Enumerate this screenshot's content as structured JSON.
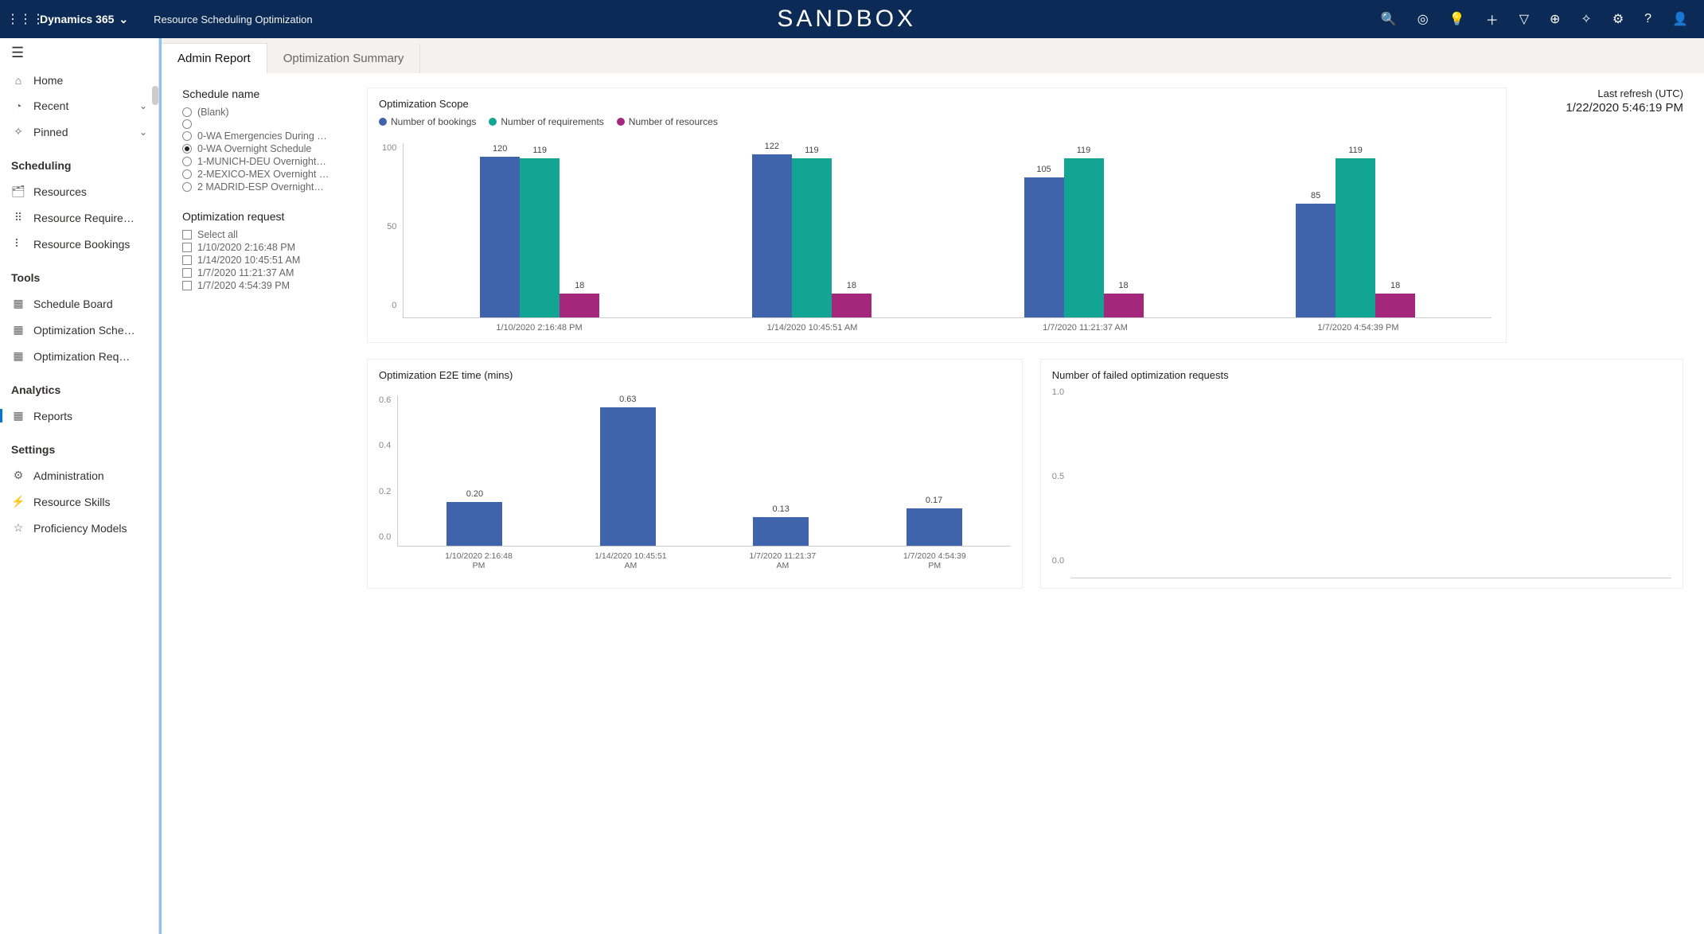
{
  "topbar": {
    "product": "Dynamics 365",
    "app": "Resource Scheduling Optimization",
    "env": "SANDBOX"
  },
  "sidebar": {
    "top": [
      {
        "icon": "⌂",
        "label": "Home"
      },
      {
        "icon": "◔",
        "label": "Recent",
        "chevron": true
      },
      {
        "icon": "✧",
        "label": "Pinned",
        "chevron": true
      }
    ],
    "sections": [
      {
        "header": "Scheduling",
        "items": [
          {
            "icon": "🗂",
            "label": "Resources"
          },
          {
            "icon": "⠿",
            "label": "Resource Require…"
          },
          {
            "icon": "⠇",
            "label": "Resource Bookings"
          }
        ]
      },
      {
        "header": "Tools",
        "items": [
          {
            "icon": "▦",
            "label": "Schedule Board"
          },
          {
            "icon": "▦",
            "label": "Optimization Sche…"
          },
          {
            "icon": "▦",
            "label": "Optimization Req…"
          }
        ]
      },
      {
        "header": "Analytics",
        "items": [
          {
            "icon": "▦",
            "label": "Reports",
            "active": true
          }
        ]
      },
      {
        "header": "Settings",
        "items": [
          {
            "icon": "⚙",
            "label": "Administration"
          },
          {
            "icon": "⚡",
            "label": "Resource Skills"
          },
          {
            "icon": "☆",
            "label": "Proficiency Models"
          }
        ]
      }
    ]
  },
  "tabs": [
    {
      "label": "Admin Report",
      "active": true
    },
    {
      "label": "Optimization Summary",
      "active": false
    }
  ],
  "filters": {
    "schedule_name_label": "Schedule name",
    "schedule_options": [
      {
        "label": "(Blank)",
        "selected": false
      },
      {
        "label": "",
        "selected": false
      },
      {
        "label": "0-WA Emergencies During …",
        "selected": false
      },
      {
        "label": "0-WA Overnight Schedule",
        "selected": true
      },
      {
        "label": "1-MUNICH-DEU Overnight…",
        "selected": false
      },
      {
        "label": "2-MEXICO-MEX Overnight …",
        "selected": false
      },
      {
        "label": "2 MADRID-ESP Overnight…",
        "selected": false
      }
    ],
    "request_label": "Optimization request",
    "request_options": [
      {
        "label": "Select all"
      },
      {
        "label": "1/10/2020 2:16:48 PM"
      },
      {
        "label": "1/14/2020 10:45:51 AM"
      },
      {
        "label": "1/7/2020 11:21:37 AM"
      },
      {
        "label": "1/7/2020 4:54:39 PM"
      }
    ]
  },
  "last_refresh": {
    "label": "Last refresh (UTC)",
    "value": "1/22/2020 5:46:19 PM"
  },
  "colors": {
    "blue": "#3f64ac",
    "teal": "#12a594",
    "purple": "#a4277c"
  },
  "chart_data": [
    {
      "id": "scope",
      "type": "bar",
      "title": "Optimization Scope",
      "categories": [
        "1/10/2020 2:16:48 PM",
        "1/14/2020 10:45:51 AM",
        "1/7/2020 11:21:37 AM",
        "1/7/2020 4:54:39 PM"
      ],
      "series": [
        {
          "name": "Number of bookings",
          "color": "#3f64ac",
          "values": [
            120,
            122,
            105,
            85
          ]
        },
        {
          "name": "Number of requirements",
          "color": "#12a594",
          "values": [
            119,
            119,
            119,
            119
          ]
        },
        {
          "name": "Number of resources",
          "color": "#a4277c",
          "values": [
            18,
            18,
            18,
            18
          ]
        }
      ],
      "ylim": [
        0,
        125
      ],
      "yticks": [
        0,
        50,
        100
      ]
    },
    {
      "id": "e2e",
      "type": "bar",
      "title": "Optimization E2E time (mins)",
      "categories": [
        "1/10/2020 2:16:48 PM",
        "1/14/2020 10:45:51 AM",
        "1/7/2020 11:21:37 AM",
        "1/7/2020 4:54:39 PM"
      ],
      "values": [
        0.2,
        0.63,
        0.13,
        0.17
      ],
      "ylim": [
        0.0,
        0.65
      ],
      "yticks": [
        0.0,
        0.2,
        0.4,
        0.6
      ]
    },
    {
      "id": "failed",
      "type": "bar",
      "title": "Number of failed optimization requests",
      "categories": [],
      "values": [],
      "ylim": [
        0.0,
        1.0
      ],
      "yticks": [
        0.0,
        0.5,
        1.0
      ]
    }
  ]
}
